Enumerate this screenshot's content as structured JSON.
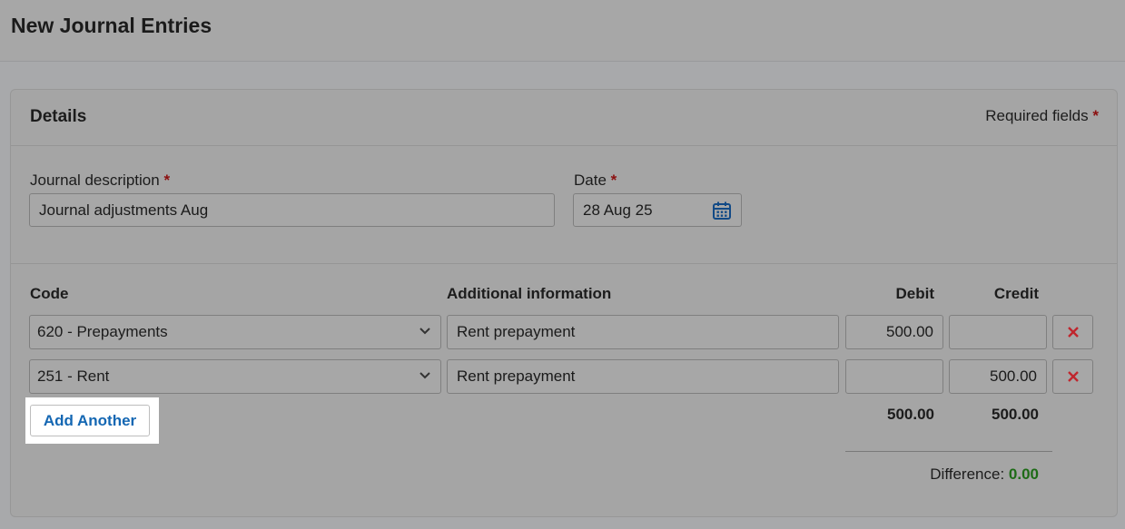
{
  "page": {
    "title": "New Journal Entries"
  },
  "details": {
    "title": "Details",
    "required_note": "Required fields",
    "required_marker": "*",
    "description_label": "Journal description",
    "description_value": "Journal adjustments Aug",
    "date_label": "Date",
    "date_value": "28 Aug 25",
    "date_icon": "calendar-icon"
  },
  "lines": {
    "headers": {
      "code": "Code",
      "info": "Additional information",
      "debit": "Debit",
      "credit": "Credit"
    },
    "rows": [
      {
        "code": "620 - Prepayments",
        "info": "Rent prepayment",
        "debit": "500.00",
        "credit": ""
      },
      {
        "code": "251 - Rent",
        "info": "Rent prepayment",
        "debit": "",
        "credit": "500.00"
      }
    ],
    "delete_icon": "close-icon",
    "add_label": "Add Another",
    "total_debit": "500.00",
    "total_credit": "500.00",
    "difference_label": "Difference:",
    "difference_value": "0.00"
  },
  "colors": {
    "required": "#8b1010",
    "link": "#1467b3",
    "delete": "#c0262d",
    "difference_ok": "#1d6b16"
  }
}
